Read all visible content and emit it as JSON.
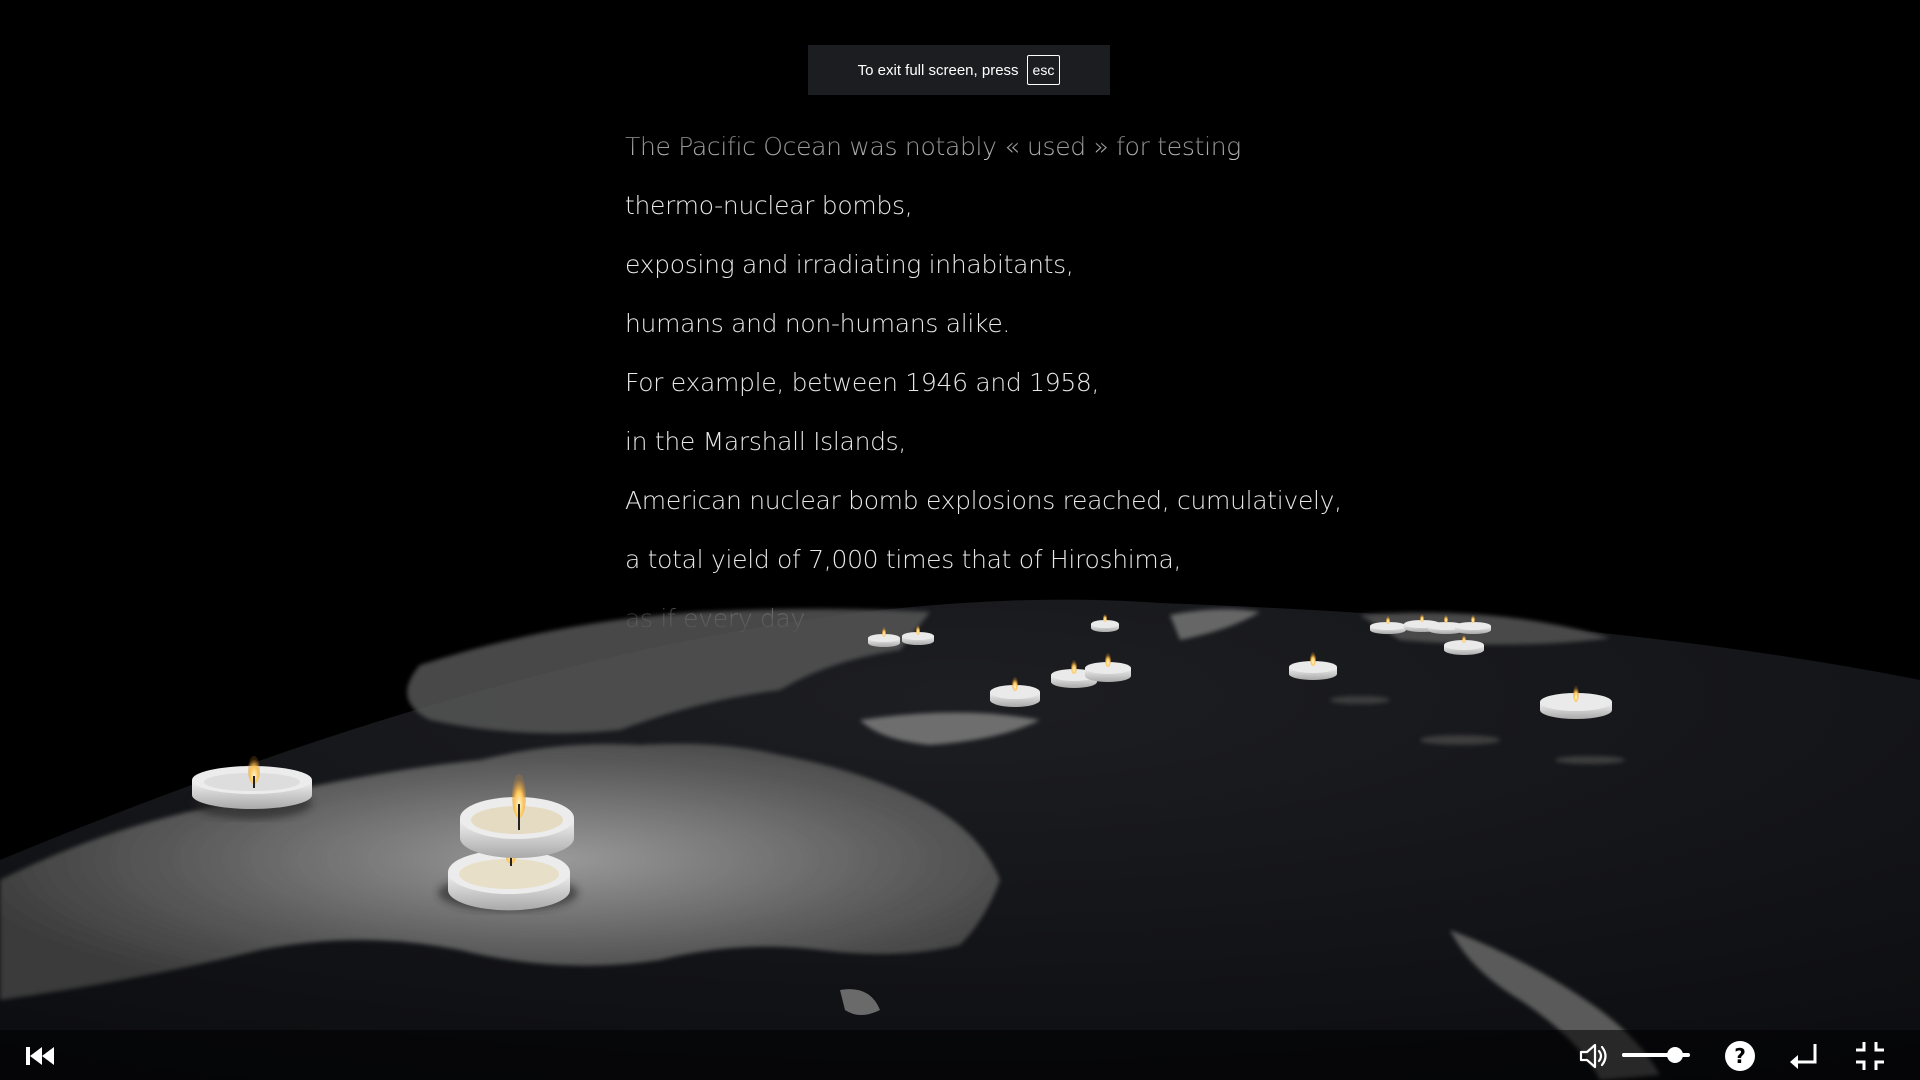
{
  "fullscreen_notice": {
    "text": "To exit full screen, press",
    "key": "esc"
  },
  "story": {
    "lines": [
      "The Pacific Ocean was notably « used » for testing",
      "thermo-nuclear bombs,",
      "exposing and irradiating inhabitants,",
      "humans and non-humans alike.",
      "For example, between 1946 and 1958,",
      "in the Marshall Islands,",
      "American nuclear bomb explosions reached, cumulatively,",
      "a total yield of 7,000 times that of Hiroshima,",
      "as if every day"
    ]
  },
  "controls": {
    "restart_icon": "skip-back-icon",
    "volume_icon": "speaker-icon",
    "volume_level": 0.78,
    "help_icon": "help-icon",
    "return_icon": "return-icon",
    "exit_fullscreen_icon": "collapse-icon"
  },
  "colors": {
    "background": "#000000",
    "globe_ocean": "#141519",
    "land": "#6a6a6a",
    "candle_wax": "#e4e4e4",
    "flame": "#ffcf6a"
  }
}
